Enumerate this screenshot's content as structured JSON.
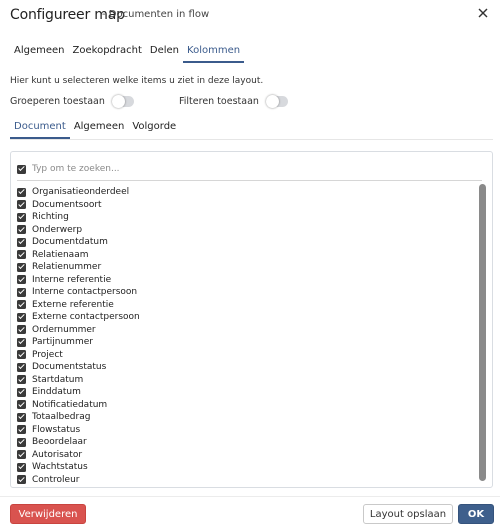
{
  "dialog": {
    "title": "Configureer map",
    "subtitle": "- Documenten in flow",
    "close_icon": "close-icon"
  },
  "main_tabs": [
    {
      "label": "Algemeen",
      "active": false
    },
    {
      "label": "Zoekopdracht",
      "active": false
    },
    {
      "label": "Delen",
      "active": false
    },
    {
      "label": "Kolommen",
      "active": true
    }
  ],
  "help_text": "Hier kunt u selecteren welke items u ziet in deze layout.",
  "toggles": {
    "group": {
      "label": "Groeperen toestaan",
      "on": false
    },
    "filter": {
      "label": "Filteren toestaan",
      "on": false
    }
  },
  "sub_tabs": [
    {
      "label": "Document",
      "active": true
    },
    {
      "label": "Algemeen",
      "active": false
    },
    {
      "label": "Volgorde",
      "active": false
    }
  ],
  "search": {
    "placeholder": "Typ om te zoeken...",
    "value": "",
    "select_all_checked": true
  },
  "items": [
    {
      "label": "Organisatieonderdeel",
      "checked": true
    },
    {
      "label": "Documentsoort",
      "checked": true
    },
    {
      "label": "Richting",
      "checked": true
    },
    {
      "label": "Onderwerp",
      "checked": true
    },
    {
      "label": "Documentdatum",
      "checked": true
    },
    {
      "label": "Relatienaam",
      "checked": true
    },
    {
      "label": "Relatienummer",
      "checked": true
    },
    {
      "label": "Interne referentie",
      "checked": true
    },
    {
      "label": "Interne contactpersoon",
      "checked": true
    },
    {
      "label": "Externe referentie",
      "checked": true
    },
    {
      "label": "Externe contactpersoon",
      "checked": true
    },
    {
      "label": "Ordernummer",
      "checked": true
    },
    {
      "label": "Partijnummer",
      "checked": true
    },
    {
      "label": "Project",
      "checked": true
    },
    {
      "label": "Documentstatus",
      "checked": true
    },
    {
      "label": "Startdatum",
      "checked": true
    },
    {
      "label": "Einddatum",
      "checked": true
    },
    {
      "label": "Notificatiedatum",
      "checked": true
    },
    {
      "label": "Totaalbedrag",
      "checked": true
    },
    {
      "label": "Flowstatus",
      "checked": true
    },
    {
      "label": "Beoordelaar",
      "checked": true
    },
    {
      "label": "Autorisator",
      "checked": true
    },
    {
      "label": "Wachtstatus",
      "checked": true
    },
    {
      "label": "Controleur",
      "checked": true
    }
  ],
  "footer": {
    "delete_label": "Verwijderen",
    "save_layout_label": "Layout opslaan",
    "ok_label": "OK"
  },
  "colors": {
    "accent": "#3e5f8c",
    "danger": "#d9534f",
    "tab_active": "#3b5b8c"
  }
}
